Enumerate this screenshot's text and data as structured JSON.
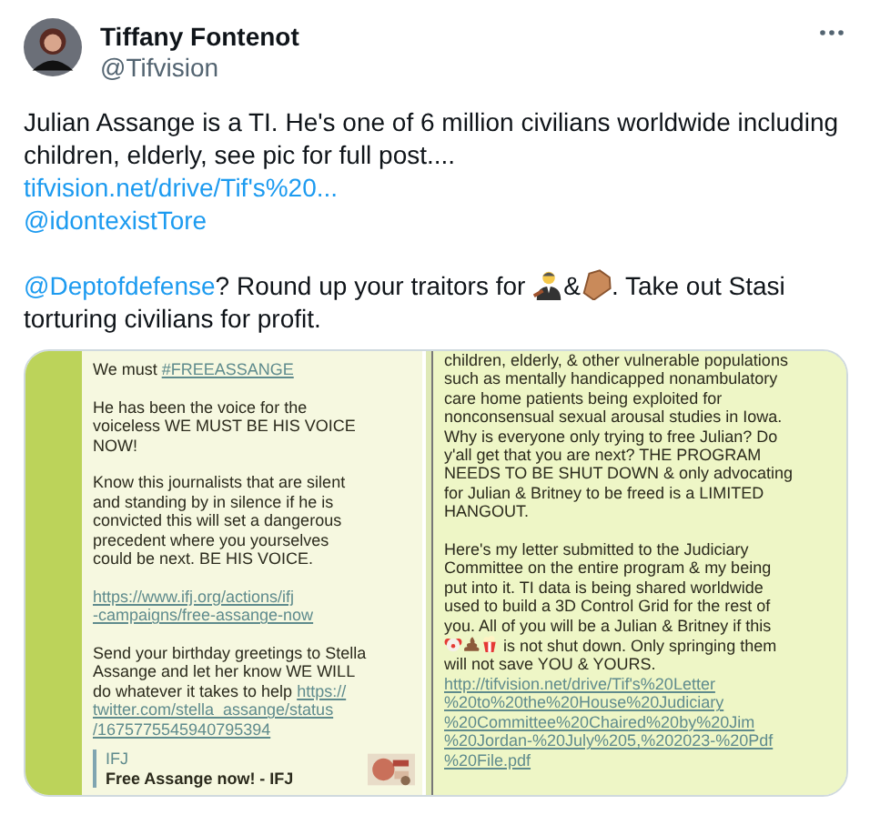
{
  "tweet": {
    "author": {
      "name": "Tiffany Fontenot",
      "handle": "@Tifvision"
    },
    "body": [
      [
        [
          {
            "kind": "text",
            "text": "Julian Assange is a TI. He's one of 6 million civilians worldwide including children, elderly, see pic for full post...."
          }
        ],
        [
          {
            "kind": "link",
            "text": "tifvision.net/drive/Tif's%20..."
          }
        ],
        [
          {
            "kind": "mention",
            "text": "@idontexistTore"
          }
        ]
      ],
      [
        [
          {
            "kind": "mention",
            "text": "@Deptofdefense"
          },
          {
            "kind": "text",
            "text": "? Round up your traitors for "
          },
          {
            "kind": "judge"
          },
          {
            "kind": "text",
            "text": "&"
          },
          {
            "kind": "coffin"
          },
          {
            "kind": "text",
            "text": ". Take out Stasi torturing civilians for profit."
          }
        ]
      ]
    ],
    "attachment": {
      "left_message": {
        "paragraphs": [
          [
            {
              "kind": "text",
              "text": "We must "
            },
            {
              "kind": "link",
              "text": "#FREEASSANGE"
            }
          ],
          [
            {
              "kind": "text",
              "text": "He has been the voice for the\nvoiceless WE MUST BE HIS VOICE\nNOW!"
            }
          ],
          [
            {
              "kind": "text",
              "text": "Know this journalists that are silent\nand standing by in silence if he is\nconvicted this will set a dangerous\nprecedent where you yourselves\ncould be next. BE HIS VOICE."
            }
          ],
          [
            {
              "kind": "link",
              "text": "https://www.ifj.org/actions/ifj\n-campaigns/free-assange-now"
            }
          ],
          [
            {
              "kind": "text",
              "text": "Send your birthday greetings to Stella\nAssange and let her know WE WILL\ndo whatever it takes to help "
            },
            {
              "kind": "link",
              "text": "https://\ntwitter.com/stella_assange/status\n/1675775545940795394"
            }
          ]
        ],
        "preview": {
          "site": "IFJ",
          "title": "Free Assange now! - IFJ"
        }
      },
      "right_message": {
        "paragraphs": [
          [
            {
              "kind": "text",
              "text": "children, elderly, & other vulnerable populations\nsuch as mentally handicapped nonambulatory\ncare home patients being exploited for\nnonconsensual sexual arousal studies in Iowa.\nWhy is everyone only trying to free Julian? Do\ny'all get that you are next? THE PROGRAM\nNEEDS TO BE SHUT DOWN & only advocating\nfor Julian & Britney to be freed is a LIMITED\nHANGOUT."
            }
          ],
          [
            {
              "kind": "text",
              "text": "Here's my letter submitted to the Judiciary\nCommittee on the entire program & my being\nput into it. TI data is being shared worldwide\nused to build a 3D Control Grid for the rest of\nyou. All of you will be a Julian & Britney if this\n"
            },
            {
              "kind": "clown"
            },
            {
              "kind": "poop"
            },
            {
              "kind": "popcorn"
            },
            {
              "kind": "text",
              "text": " is not shut down. Only springing them\nwill not save YOU & YOURS.\n"
            },
            {
              "kind": "link",
              "text": "http://tifvision.net/drive/Tif's%20Letter\n%20to%20the%20House%20Judiciary\n%20Committee%20Chaired%20by%20Jim\n%20Jordan-%20July%205,%202023-%20Pdf\n%20File.pdf"
            }
          ]
        ]
      }
    }
  }
}
